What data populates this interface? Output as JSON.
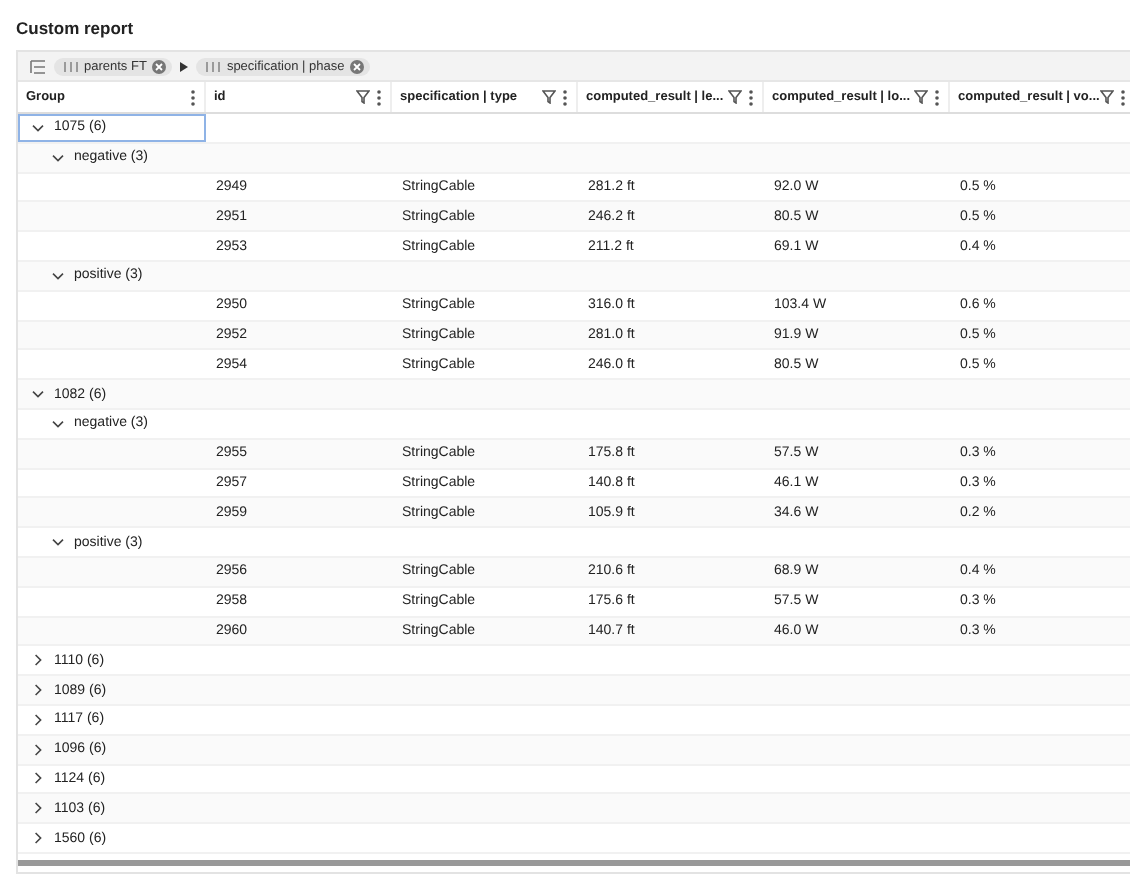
{
  "title": "Custom report",
  "group_chips": [
    {
      "label": "parents FT"
    },
    {
      "label": "specification | phase"
    }
  ],
  "columns": [
    {
      "label": "Group",
      "filter": false
    },
    {
      "label": "id",
      "filter": true
    },
    {
      "label": "specification | type",
      "filter": true
    },
    {
      "label": "computed_result | le...",
      "filter": true
    },
    {
      "label": "computed_result | lo...",
      "filter": true
    },
    {
      "label": "computed_result | vo...",
      "filter": true
    }
  ],
  "rows": [
    {
      "label": "1075 (6)",
      "expanded": true,
      "selected": true,
      "children": [
        {
          "label": "negative (3)",
          "expanded": true,
          "selected": false,
          "children": [
            {
              "cells": [
                "2949",
                "StringCable",
                "281.2 ft",
                "92.0 W",
                "0.5 %"
              ]
            },
            {
              "cells": [
                "2951",
                "StringCable",
                "246.2 ft",
                "80.5 W",
                "0.5 %"
              ]
            },
            {
              "cells": [
                "2953",
                "StringCable",
                "211.2 ft",
                "69.1 W",
                "0.4 %"
              ]
            }
          ]
        },
        {
          "label": "positive (3)",
          "expanded": true,
          "selected": false,
          "children": [
            {
              "cells": [
                "2950",
                "StringCable",
                "316.0 ft",
                "103.4 W",
                "0.6 %"
              ]
            },
            {
              "cells": [
                "2952",
                "StringCable",
                "281.0 ft",
                "91.9 W",
                "0.5 %"
              ]
            },
            {
              "cells": [
                "2954",
                "StringCable",
                "246.0 ft",
                "80.5 W",
                "0.5 %"
              ]
            }
          ]
        }
      ]
    },
    {
      "label": "1082 (6)",
      "expanded": true,
      "selected": false,
      "children": [
        {
          "label": "negative (3)",
          "expanded": true,
          "selected": false,
          "children": [
            {
              "cells": [
                "2955",
                "StringCable",
                "175.8 ft",
                "57.5 W",
                "0.3 %"
              ]
            },
            {
              "cells": [
                "2957",
                "StringCable",
                "140.8 ft",
                "46.1 W",
                "0.3 %"
              ]
            },
            {
              "cells": [
                "2959",
                "StringCable",
                "105.9 ft",
                "34.6 W",
                "0.2 %"
              ]
            }
          ]
        },
        {
          "label": "positive (3)",
          "expanded": true,
          "selected": false,
          "children": [
            {
              "cells": [
                "2956",
                "StringCable",
                "210.6 ft",
                "68.9 W",
                "0.4 %"
              ]
            },
            {
              "cells": [
                "2958",
                "StringCable",
                "175.6 ft",
                "57.5 W",
                "0.3 %"
              ]
            },
            {
              "cells": [
                "2960",
                "StringCable",
                "140.7 ft",
                "46.0 W",
                "0.3 %"
              ]
            }
          ]
        }
      ]
    },
    {
      "label": "1110 (6)",
      "expanded": false,
      "selected": false
    },
    {
      "label": "1089 (6)",
      "expanded": false,
      "selected": false
    },
    {
      "label": "1117 (6)",
      "expanded": false,
      "selected": false
    },
    {
      "label": "1096 (6)",
      "expanded": false,
      "selected": false
    },
    {
      "label": "1124 (6)",
      "expanded": false,
      "selected": false
    },
    {
      "label": "1103 (6)",
      "expanded": false,
      "selected": false
    },
    {
      "label": "1560 (6)",
      "expanded": false,
      "selected": false
    }
  ]
}
